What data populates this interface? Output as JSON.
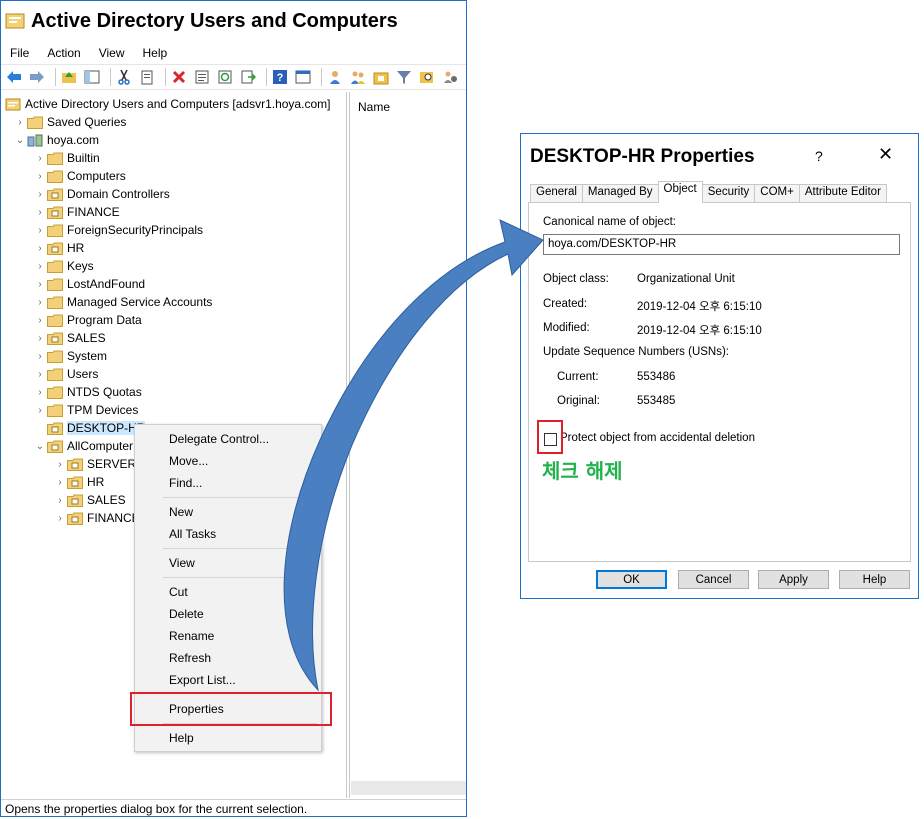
{
  "main_window": {
    "title": "Active Directory Users and Computers",
    "menu": [
      "File",
      "Action",
      "View",
      "Help"
    ],
    "toolbar_icons": [
      "back-icon",
      "forward-icon",
      "up-icon",
      "show-tree-icon",
      "cut-icon",
      "copy-icon",
      "delete-icon",
      "properties-icon",
      "refresh-icon",
      "export-icon",
      "help-icon",
      "details-icon",
      "new-user-icon",
      "new-group-icon",
      "new-ou-icon",
      "filter-icon",
      "find-icon",
      "add-member-icon"
    ],
    "tree": [
      {
        "label": "Active Directory Users and Computers [adsvr1.hoya.com]",
        "level": 0,
        "expander": "",
        "icon": "aduc"
      },
      {
        "label": "Saved Queries",
        "level": 1,
        "expander": "›",
        "icon": "folder"
      },
      {
        "label": "hoya.com",
        "level": 1,
        "expander": "⌄",
        "icon": "domain"
      },
      {
        "label": "Builtin",
        "level": 2,
        "expander": "›",
        "icon": "folder"
      },
      {
        "label": "Computers",
        "level": 2,
        "expander": "›",
        "icon": "folder"
      },
      {
        "label": "Domain Controllers",
        "level": 2,
        "expander": "›",
        "icon": "ou"
      },
      {
        "label": "FINANCE",
        "level": 2,
        "expander": "›",
        "icon": "ou"
      },
      {
        "label": "ForeignSecurityPrincipals",
        "level": 2,
        "expander": "›",
        "icon": "folder"
      },
      {
        "label": "HR",
        "level": 2,
        "expander": "›",
        "icon": "ou"
      },
      {
        "label": "Keys",
        "level": 2,
        "expander": "›",
        "icon": "folder"
      },
      {
        "label": "LostAndFound",
        "level": 2,
        "expander": "›",
        "icon": "folder"
      },
      {
        "label": "Managed Service Accounts",
        "level": 2,
        "expander": "›",
        "icon": "folder"
      },
      {
        "label": "Program Data",
        "level": 2,
        "expander": "›",
        "icon": "folder"
      },
      {
        "label": "SALES",
        "level": 2,
        "expander": "›",
        "icon": "ou"
      },
      {
        "label": "System",
        "level": 2,
        "expander": "›",
        "icon": "folder"
      },
      {
        "label": "Users",
        "level": 2,
        "expander": "›",
        "icon": "folder"
      },
      {
        "label": "NTDS Quotas",
        "level": 2,
        "expander": "›",
        "icon": "folder"
      },
      {
        "label": "TPM Devices",
        "level": 2,
        "expander": "›",
        "icon": "folder"
      },
      {
        "label": "DESKTOP-HR",
        "level": 2,
        "expander": "",
        "icon": "ou",
        "selected": true
      },
      {
        "label": "AllComputer",
        "level": 2,
        "expander": "⌄",
        "icon": "ou"
      },
      {
        "label": "SERVER",
        "level": 3,
        "expander": "›",
        "icon": "ou"
      },
      {
        "label": "HR",
        "level": 3,
        "expander": "›",
        "icon": "ou"
      },
      {
        "label": "SALES",
        "level": 3,
        "expander": "›",
        "icon": "ou"
      },
      {
        "label": "FINANCE",
        "level": 3,
        "expander": "›",
        "icon": "ou"
      }
    ],
    "list_header": "Name",
    "status": "Opens the properties dialog box for the current selection."
  },
  "context_menu": {
    "delegate": "Delegate Control...",
    "move": "Move...",
    "find": "Find...",
    "new": "New",
    "all_tasks": "All Tasks",
    "view": "View",
    "cut": "Cut",
    "delete": "Delete",
    "rename": "Rename",
    "refresh": "Refresh",
    "export": "Export List...",
    "properties": "Properties",
    "help": "Help",
    "submenu_arrow": "›"
  },
  "dialog": {
    "title": "DESKTOP-HR Properties",
    "help_glyph": "?",
    "close_glyph": "✕",
    "tabs": [
      "General",
      "Managed By",
      "Object",
      "Security",
      "COM+",
      "Attribute Editor"
    ],
    "active_tab": "Object",
    "canonical_label": "Canonical name of object:",
    "canonical_value": "hoya.com/DESKTOP-HR",
    "object_class_label": "Object class:",
    "object_class_value": "Organizational Unit",
    "created_label": "Created:",
    "created_value": "2019-12-04 오후 6:15:10",
    "modified_label": "Modified:",
    "modified_value": "2019-12-04 오후 6:15:10",
    "usn_label": "Update Sequence Numbers (USNs):",
    "current_label": "Current:",
    "current_value": "553486",
    "original_label": "Original:",
    "original_value": "553485",
    "protect_label": "Protect object from accidental deletion",
    "protect_checked": false,
    "note": "체크 해제",
    "note_color": "#22b24c",
    "ok": "OK",
    "cancel": "Cancel",
    "apply": "Apply",
    "help": "Help"
  },
  "colors": {
    "highlight": "#e0202a",
    "arrow": "#4a7fc1",
    "window_border": "#1e6fc7",
    "selection": "#cce8ff"
  }
}
